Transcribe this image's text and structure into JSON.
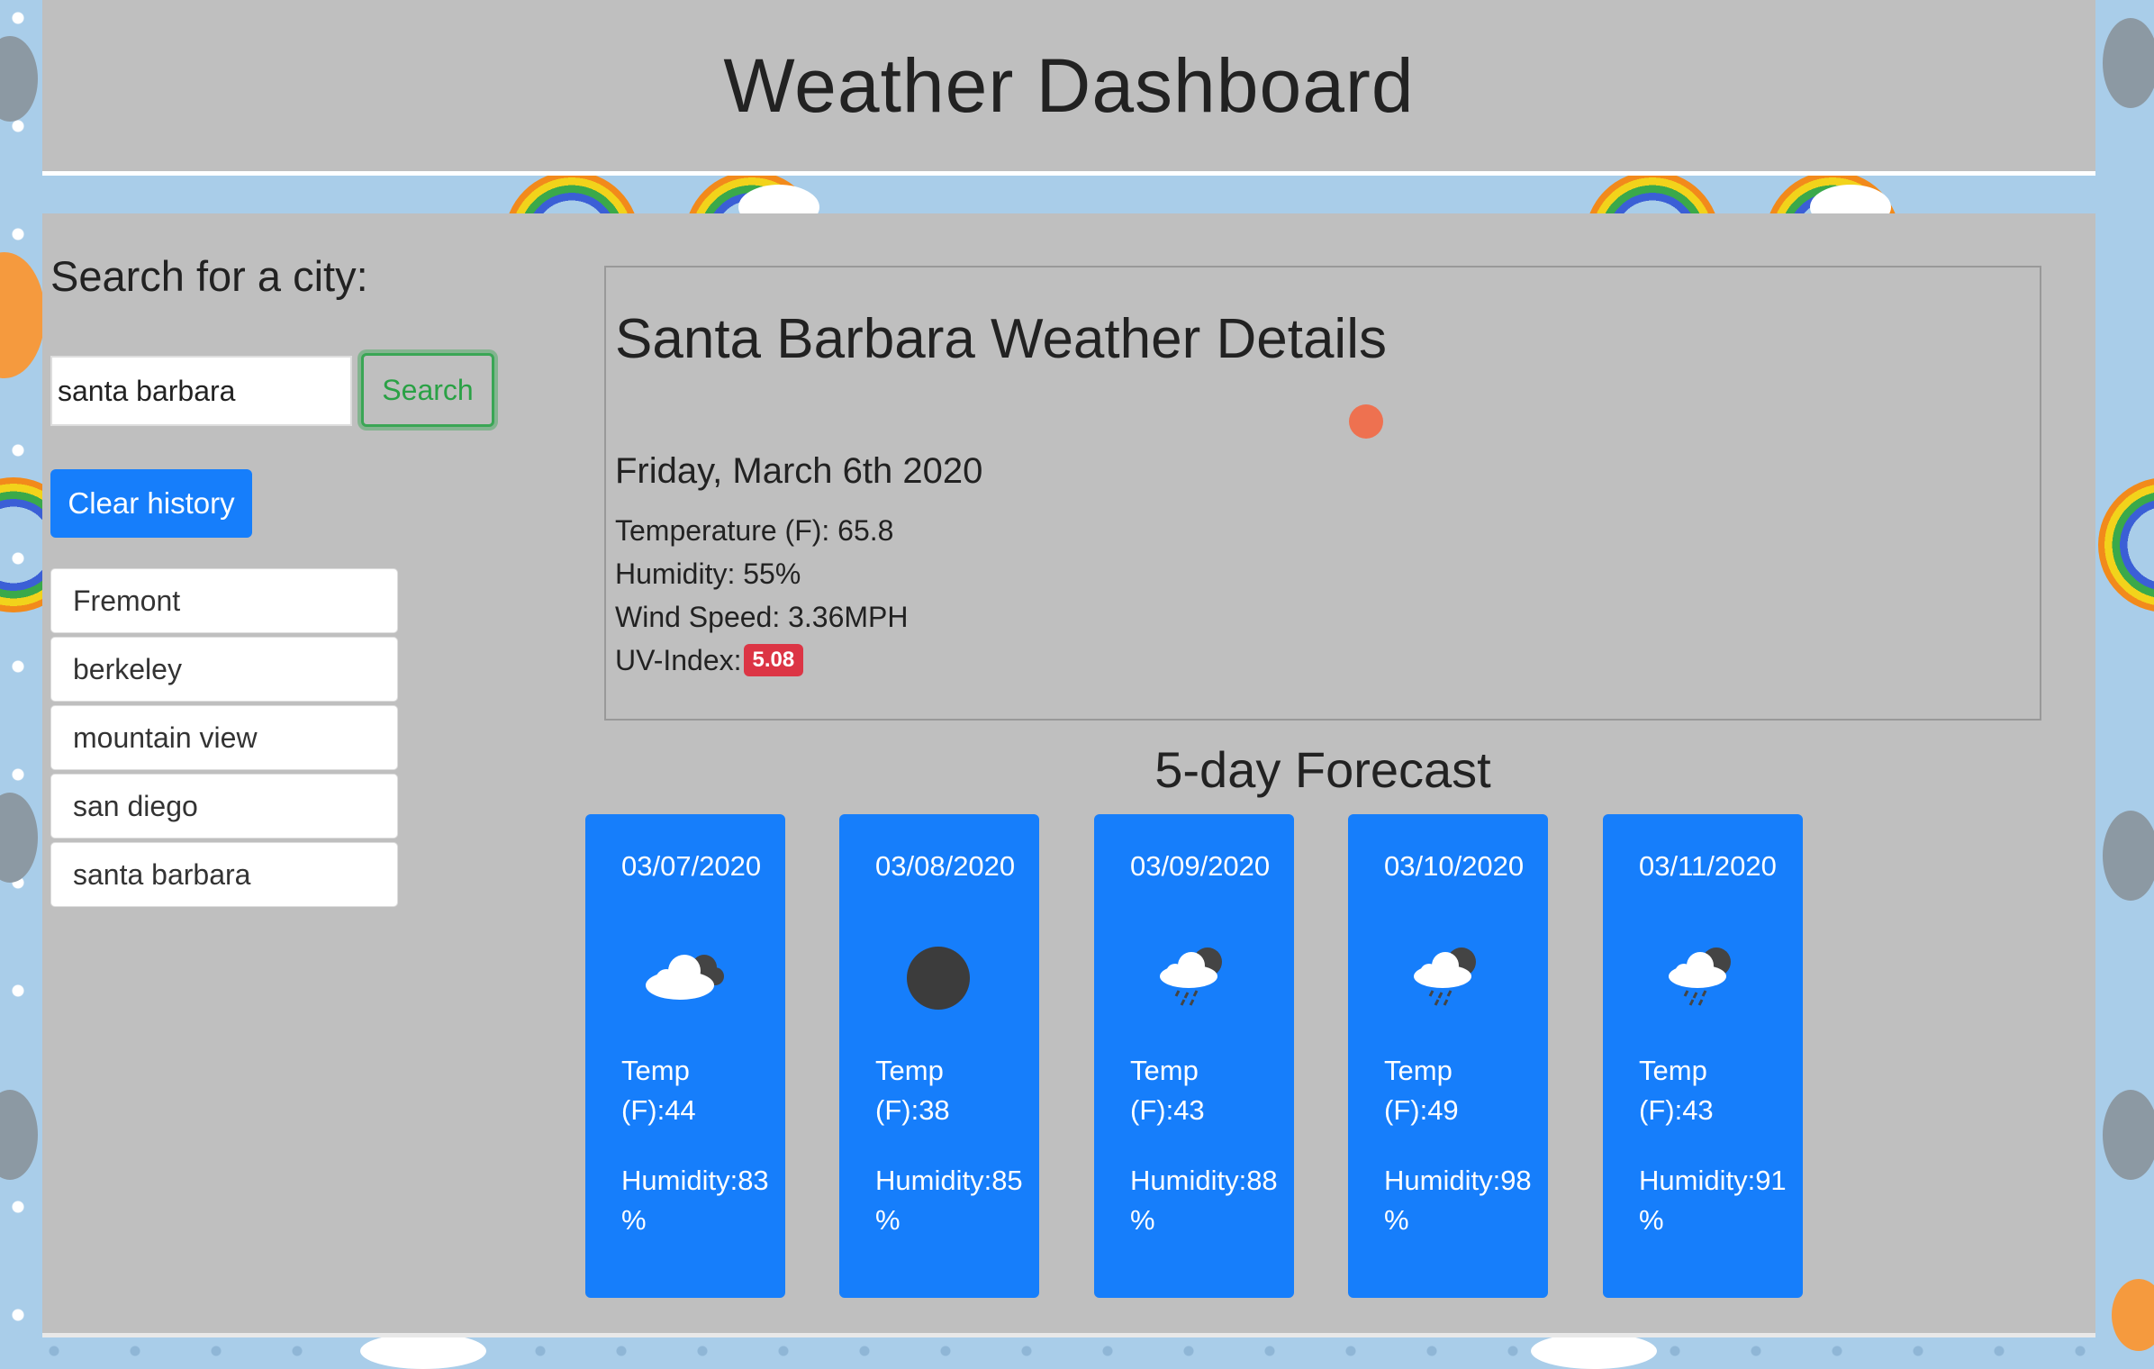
{
  "header": {
    "title": "Weather Dashboard"
  },
  "search": {
    "label": "Search for a city:",
    "input_value": "santa barbara",
    "button_label": "Search",
    "clear_label": "Clear history"
  },
  "history": [
    "Fremont",
    "berkeley",
    "mountain view",
    "san diego",
    "santa barbara"
  ],
  "details": {
    "title": "Santa Barbara Weather Details",
    "date": "Friday, March 6th 2020",
    "temperature": "Temperature (F): 65.8",
    "humidity": "Humidity: 55%",
    "wind": "Wind Speed: 3.36MPH",
    "uv_label": "UV-Index:",
    "uv_value": "5.08",
    "uv_color": "#dc3545"
  },
  "forecast": {
    "title": "5-day Forecast",
    "days": [
      {
        "date": "03/07/2020",
        "icon": "cloudy-night-icon",
        "temp": "Temp (F):44",
        "humidity": "Humidity:83 %"
      },
      {
        "date": "03/08/2020",
        "icon": "dark-moon-icon",
        "temp": "Temp (F):38",
        "humidity": "Humidity:85 %"
      },
      {
        "date": "03/09/2020",
        "icon": "rain-night-icon",
        "temp": "Temp (F):43",
        "humidity": "Humidity:88 %"
      },
      {
        "date": "03/10/2020",
        "icon": "rain-night-icon",
        "temp": "Temp (F):49",
        "humidity": "Humidity:98 %"
      },
      {
        "date": "03/11/2020",
        "icon": "rain-night-icon",
        "temp": "Temp (F):43",
        "humidity": "Humidity:91 %"
      }
    ]
  },
  "colors": {
    "accent": "#167efb",
    "panel": "#bfbfbf",
    "search_green": "#2aa145"
  }
}
